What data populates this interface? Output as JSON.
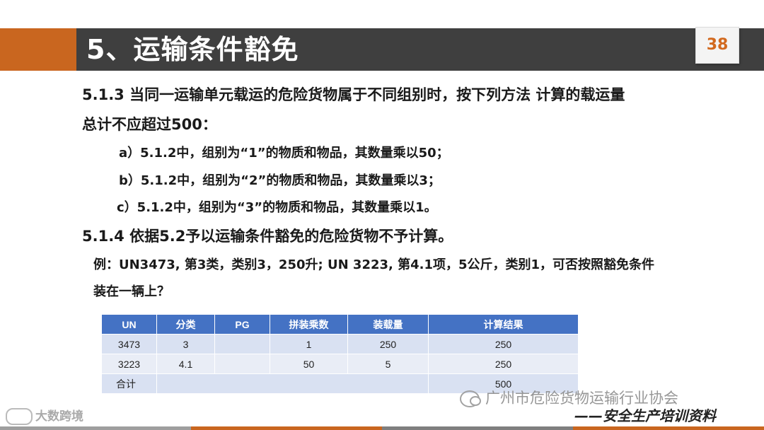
{
  "slide": {
    "title": "5、运输条件豁免",
    "page_number": "38"
  },
  "content": {
    "line1": "5.1.3  当同一运输单元载运的危险货物属于不同组别时，按下列方法 计算的载运量",
    "line2": "总计不应超过500：",
    "sub_a": "a）5.1.2中，组别为“1”的物质和物品，其数量乘以50；",
    "sub_b": "b）5.1.2中，组别为“2”的物质和物品，其数量乘以3；",
    "sub_c": "c）5.1.2中，组别为“3”的物质和物品，其数量乘以1。",
    "line4": "5.1.4  依据5.2予以运输条件豁免的危险货物不予计算。",
    "example1": "例：UN3473, 第3类，类别3，250升; UN 3223, 第4.1项，5公斤，类别1，可否按照豁免条件",
    "example2": "装在一辆上？"
  },
  "table": {
    "headers": [
      "UN",
      "分类",
      "PG",
      "拼装乘数",
      "装载量",
      "计算结果"
    ],
    "rows": [
      [
        "3473",
        "3",
        "",
        "1",
        "250",
        "250"
      ],
      [
        "3223",
        "4.1",
        "",
        "50",
        "5",
        "250"
      ]
    ],
    "total_label": "合计",
    "total_value": "500"
  },
  "footer": {
    "watermark": "广州市危险货物运输行业协会",
    "slogan": "——安全生产培训资料",
    "brand": "大数跨境"
  },
  "colors": {
    "accent_orange": "#c9661f",
    "title_bar": "#3f3f3f",
    "table_header": "#4472c4",
    "table_row": "#d9e1f2"
  }
}
